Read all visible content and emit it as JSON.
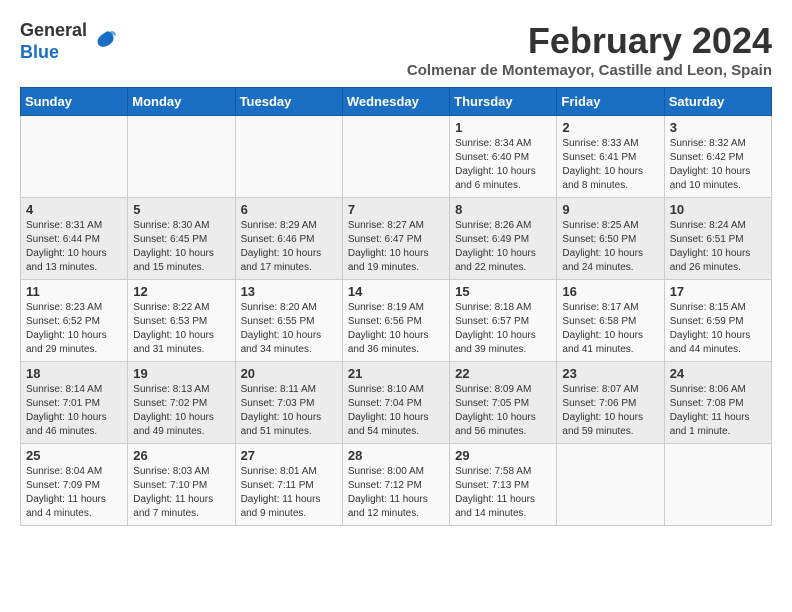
{
  "logo": {
    "general": "General",
    "blue": "Blue"
  },
  "title": "February 2024",
  "location": "Colmenar de Montemayor, Castille and Leon, Spain",
  "days_header": [
    "Sunday",
    "Monday",
    "Tuesday",
    "Wednesday",
    "Thursday",
    "Friday",
    "Saturday"
  ],
  "weeks": [
    [
      {
        "day": "",
        "info": ""
      },
      {
        "day": "",
        "info": ""
      },
      {
        "day": "",
        "info": ""
      },
      {
        "day": "",
        "info": ""
      },
      {
        "day": "1",
        "info": "Sunrise: 8:34 AM\nSunset: 6:40 PM\nDaylight: 10 hours\nand 6 minutes."
      },
      {
        "day": "2",
        "info": "Sunrise: 8:33 AM\nSunset: 6:41 PM\nDaylight: 10 hours\nand 8 minutes."
      },
      {
        "day": "3",
        "info": "Sunrise: 8:32 AM\nSunset: 6:42 PM\nDaylight: 10 hours\nand 10 minutes."
      }
    ],
    [
      {
        "day": "4",
        "info": "Sunrise: 8:31 AM\nSunset: 6:44 PM\nDaylight: 10 hours\nand 13 minutes."
      },
      {
        "day": "5",
        "info": "Sunrise: 8:30 AM\nSunset: 6:45 PM\nDaylight: 10 hours\nand 15 minutes."
      },
      {
        "day": "6",
        "info": "Sunrise: 8:29 AM\nSunset: 6:46 PM\nDaylight: 10 hours\nand 17 minutes."
      },
      {
        "day": "7",
        "info": "Sunrise: 8:27 AM\nSunset: 6:47 PM\nDaylight: 10 hours\nand 19 minutes."
      },
      {
        "day": "8",
        "info": "Sunrise: 8:26 AM\nSunset: 6:49 PM\nDaylight: 10 hours\nand 22 minutes."
      },
      {
        "day": "9",
        "info": "Sunrise: 8:25 AM\nSunset: 6:50 PM\nDaylight: 10 hours\nand 24 minutes."
      },
      {
        "day": "10",
        "info": "Sunrise: 8:24 AM\nSunset: 6:51 PM\nDaylight: 10 hours\nand 26 minutes."
      }
    ],
    [
      {
        "day": "11",
        "info": "Sunrise: 8:23 AM\nSunset: 6:52 PM\nDaylight: 10 hours\nand 29 minutes."
      },
      {
        "day": "12",
        "info": "Sunrise: 8:22 AM\nSunset: 6:53 PM\nDaylight: 10 hours\nand 31 minutes."
      },
      {
        "day": "13",
        "info": "Sunrise: 8:20 AM\nSunset: 6:55 PM\nDaylight: 10 hours\nand 34 minutes."
      },
      {
        "day": "14",
        "info": "Sunrise: 8:19 AM\nSunset: 6:56 PM\nDaylight: 10 hours\nand 36 minutes."
      },
      {
        "day": "15",
        "info": "Sunrise: 8:18 AM\nSunset: 6:57 PM\nDaylight: 10 hours\nand 39 minutes."
      },
      {
        "day": "16",
        "info": "Sunrise: 8:17 AM\nSunset: 6:58 PM\nDaylight: 10 hours\nand 41 minutes."
      },
      {
        "day": "17",
        "info": "Sunrise: 8:15 AM\nSunset: 6:59 PM\nDaylight: 10 hours\nand 44 minutes."
      }
    ],
    [
      {
        "day": "18",
        "info": "Sunrise: 8:14 AM\nSunset: 7:01 PM\nDaylight: 10 hours\nand 46 minutes."
      },
      {
        "day": "19",
        "info": "Sunrise: 8:13 AM\nSunset: 7:02 PM\nDaylight: 10 hours\nand 49 minutes."
      },
      {
        "day": "20",
        "info": "Sunrise: 8:11 AM\nSunset: 7:03 PM\nDaylight: 10 hours\nand 51 minutes."
      },
      {
        "day": "21",
        "info": "Sunrise: 8:10 AM\nSunset: 7:04 PM\nDaylight: 10 hours\nand 54 minutes."
      },
      {
        "day": "22",
        "info": "Sunrise: 8:09 AM\nSunset: 7:05 PM\nDaylight: 10 hours\nand 56 minutes."
      },
      {
        "day": "23",
        "info": "Sunrise: 8:07 AM\nSunset: 7:06 PM\nDaylight: 10 hours\nand 59 minutes."
      },
      {
        "day": "24",
        "info": "Sunrise: 8:06 AM\nSunset: 7:08 PM\nDaylight: 11 hours\nand 1 minute."
      }
    ],
    [
      {
        "day": "25",
        "info": "Sunrise: 8:04 AM\nSunset: 7:09 PM\nDaylight: 11 hours\nand 4 minutes."
      },
      {
        "day": "26",
        "info": "Sunrise: 8:03 AM\nSunset: 7:10 PM\nDaylight: 11 hours\nand 7 minutes."
      },
      {
        "day": "27",
        "info": "Sunrise: 8:01 AM\nSunset: 7:11 PM\nDaylight: 11 hours\nand 9 minutes."
      },
      {
        "day": "28",
        "info": "Sunrise: 8:00 AM\nSunset: 7:12 PM\nDaylight: 11 hours\nand 12 minutes."
      },
      {
        "day": "29",
        "info": "Sunrise: 7:58 AM\nSunset: 7:13 PM\nDaylight: 11 hours\nand 14 minutes."
      },
      {
        "day": "",
        "info": ""
      },
      {
        "day": "",
        "info": ""
      }
    ]
  ]
}
